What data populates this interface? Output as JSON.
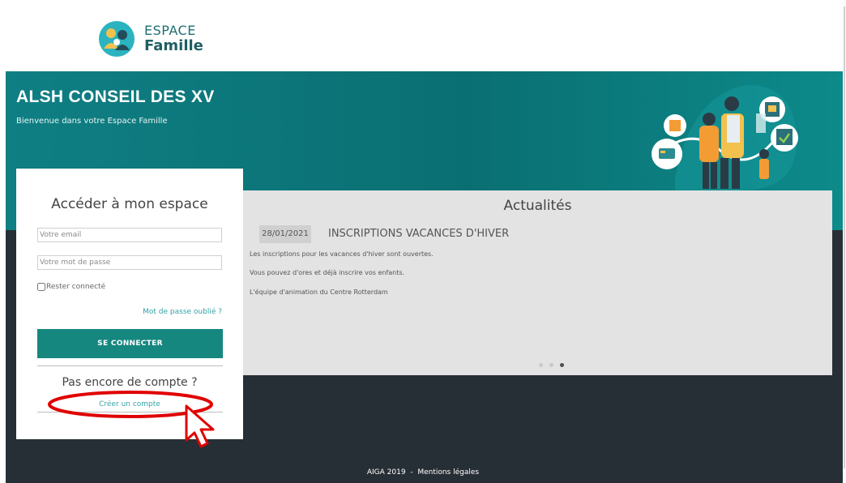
{
  "brand": {
    "line1": "ESPACE",
    "line2": "Famille"
  },
  "hero": {
    "title": "ALSH CONSEIL DES XV",
    "subtitle": "Bienvenue dans votre Espace Famille"
  },
  "login": {
    "title": "Accéder à mon espace",
    "email_placeholder": "Votre email",
    "password_placeholder": "Votre mot de passe",
    "remember_label": "Rester connecté",
    "forgot_link": "Mot de passe oublié ?",
    "submit_label": "SE CONNECTER",
    "no_account": "Pas encore de compte ?",
    "create_link": "Créer un compte"
  },
  "news": {
    "heading": "Actualités",
    "date": "28/01/2021",
    "title": "INSCRIPTIONS VACANCES D'HIVER",
    "lines": [
      "Les inscriptions pour les vacances d'hiver sont ouvertes.",
      "Vous pouvez d'ores et déjà inscrire vos enfants.",
      "L'équipe d'animation du Centre Rotterdam"
    ],
    "carousel": {
      "count": 3,
      "active": 3
    }
  },
  "footer": {
    "copyright": "AIGA 2019",
    "separator": "-",
    "legal": "Mentions légales"
  },
  "colors": {
    "teal": "#0f7f84",
    "button": "#16877f",
    "dark": "#272f36",
    "link": "#35a2a6",
    "annotation": "#e00000"
  },
  "icons": [
    "family-logo-icon",
    "family-illustration",
    "highlight-oval",
    "pointer-cursor-icon"
  ]
}
